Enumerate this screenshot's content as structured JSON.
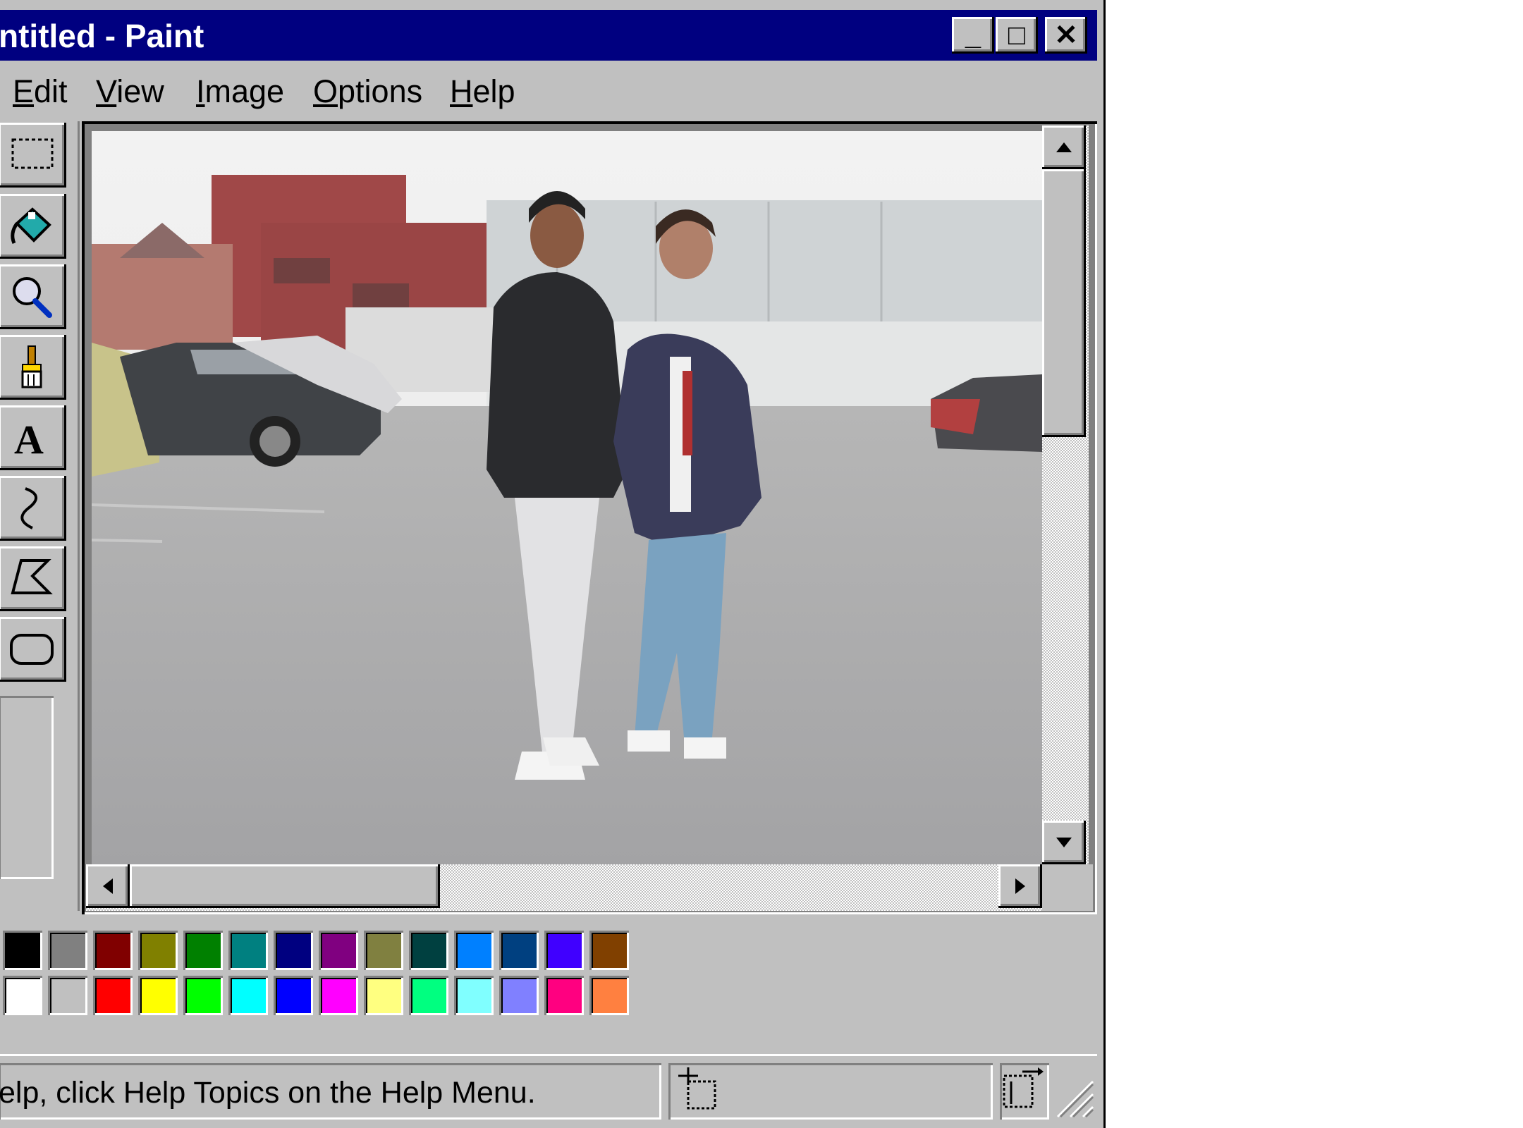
{
  "window": {
    "title": "ntitled - Paint",
    "title_buttons": {
      "minimize": "_",
      "maximize": "□",
      "close": "✕"
    }
  },
  "menu": [
    {
      "label": "Edit",
      "accel": "E",
      "rest": "dit"
    },
    {
      "label": "View",
      "accel": "V",
      "rest": "iew"
    },
    {
      "label": "Image",
      "accel": "I",
      "rest": "mage"
    },
    {
      "label": "Options",
      "accel": "O",
      "rest": "ptions"
    },
    {
      "label": "Help",
      "accel": "H",
      "rest": "elp"
    }
  ],
  "tools": [
    "select-rectangle",
    "fill-with-color",
    "magnifier",
    "brush",
    "text",
    "curve",
    "polygon",
    "rounded-rectangle"
  ],
  "palette": {
    "top_row": [
      "#000000",
      "#808080",
      "#800000",
      "#808000",
      "#008000",
      "#008080",
      "#000080",
      "#800080",
      "#808040",
      "#004040",
      "#0080ff",
      "#004080",
      "#4000ff",
      "#804000"
    ],
    "bottom_row": [
      "#ffffff",
      "#c0c0c0",
      "#ff0000",
      "#ffff00",
      "#00ff00",
      "#00ffff",
      "#0000ff",
      "#ff00ff",
      "#ffff80",
      "#00ff80",
      "#80ffff",
      "#8080ff",
      "#ff0080",
      "#ff8040"
    ]
  },
  "status": {
    "message": "elp, click Help Topics on the Help Menu."
  },
  "colors": {
    "title_bar": "#000080",
    "face": "#c0c0c0"
  }
}
